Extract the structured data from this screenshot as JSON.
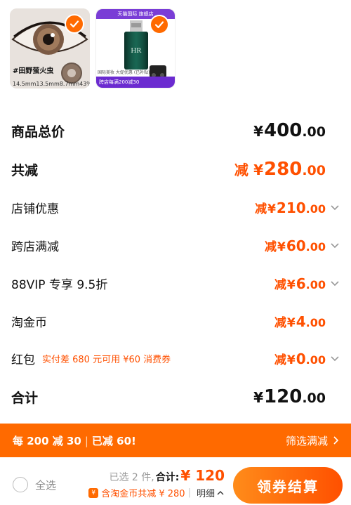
{
  "products": [
    {
      "label": "#田野萤火虫",
      "specs": [
        "14.5mm",
        "13.5mm",
        "8.7mm",
        "43%"
      ],
      "selected": true
    },
    {
      "banner": "天猫国际 旗舰店",
      "promo_small": "国际美妆 大促优惠 (已补贴)",
      "promo_bar": "跨店每满200减30",
      "selected": true
    }
  ],
  "summary_rows": {
    "subtotal": {
      "label": "商品总价",
      "currency": "¥",
      "int": "400",
      "dec": ".00"
    },
    "total_discount": {
      "label": "共减",
      "prefix": "减",
      "currency": "¥",
      "int": "280",
      "dec": ".00"
    },
    "store_discount": {
      "label": "店铺优惠",
      "prefix": "减",
      "currency": "¥",
      "int": "210",
      "dec": ".00"
    },
    "cross_store": {
      "label": "跨店满减",
      "prefix": "减",
      "currency": "¥",
      "int": "60",
      "dec": ".00"
    },
    "vip": {
      "label": "88VIP 专享 9.5折",
      "prefix": "减",
      "currency": "¥",
      "int": "6",
      "dec": ".00"
    },
    "taojinbi": {
      "label": "淘金币",
      "prefix": "减",
      "currency": "¥",
      "int": "4",
      "dec": ".00"
    },
    "red_packet": {
      "label": "红包",
      "note": "实付差 680 元可用 ¥60 消费券",
      "prefix": "减",
      "currency": "¥",
      "int": "0",
      "dec": ".00"
    },
    "grand_total": {
      "label": "合计",
      "currency": "¥",
      "int": "120",
      "dec": ".00"
    }
  },
  "promo_bar": {
    "part1": "每 200 减 30",
    "sep": "|",
    "part2": "已减 60!",
    "link": "筛选满减"
  },
  "footer": {
    "select_all": "全选",
    "selected_count": "已选 2 件,",
    "total_label": "合计:",
    "total_value": "¥ 120",
    "coin_text": "含淘金币共减 ¥ 280",
    "detail_sep": "|",
    "detail": "明细",
    "checkout": "领券结算"
  },
  "colors": {
    "accent": "#ff5000",
    "bar": "#ff6a00"
  }
}
